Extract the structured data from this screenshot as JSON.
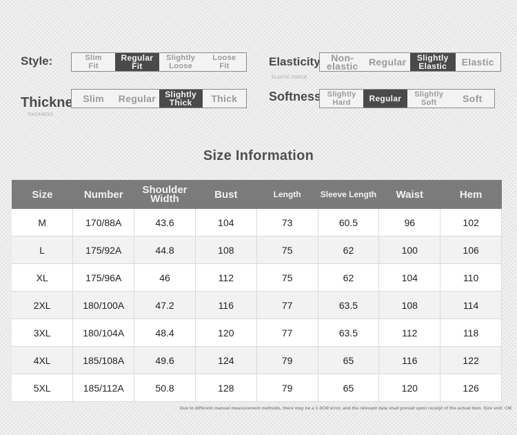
{
  "attributes": {
    "style": {
      "label": "Style:",
      "options": [
        "Slim\nFit",
        "Regular\nFit",
        "Slightly\nLoose",
        "Loose\nFit"
      ],
      "selected": 1
    },
    "elasticity": {
      "label": "Elasticity:",
      "sub": "ELASTIC FORCE",
      "options": [
        "Non-elastic",
        "Regular",
        "Slightly\nElastic",
        "Elastic"
      ],
      "selected": 2
    },
    "thickness": {
      "label": "Thickness:",
      "sub": "THICKNESS",
      "options": [
        "Slim",
        "Regular",
        "Slightly\nThick",
        "Thick"
      ],
      "selected": 2
    },
    "softness": {
      "label": "Softness:",
      "options": [
        "Slightly\nHard",
        "Regular",
        "Slightly\nSoft",
        "Soft"
      ],
      "selected": 1
    }
  },
  "size_info": {
    "title": "Size Information",
    "headers": [
      "Size",
      "Number",
      "Shoulder Width",
      "Bust",
      "Length",
      "Sleeve Length",
      "Waist",
      "Hem"
    ],
    "rows": [
      [
        "M",
        "170/88A",
        "43.6",
        "104",
        "73",
        "60.5",
        "96",
        "102"
      ],
      [
        "L",
        "175/92A",
        "44.8",
        "108",
        "75",
        "62",
        "100",
        "106"
      ],
      [
        "XL",
        "175/96A",
        "46",
        "112",
        "75",
        "62",
        "104",
        "110"
      ],
      [
        "2XL",
        "180/100A",
        "47.2",
        "116",
        "77",
        "63.5",
        "108",
        "114"
      ],
      [
        "3XL",
        "180/104A",
        "48.4",
        "120",
        "77",
        "63.5",
        "112",
        "118"
      ],
      [
        "4XL",
        "185/108A",
        "49.6",
        "124",
        "79",
        "65",
        "116",
        "122"
      ],
      [
        "5XL",
        "185/112A",
        "50.8",
        "128",
        "79",
        "65",
        "120",
        "126"
      ]
    ]
  },
  "note": "Due to different manual measurement methods, there may be a 1-3CM error, and the relevant data shall prevail upon receipt of the actual item. Size unit: CM"
}
